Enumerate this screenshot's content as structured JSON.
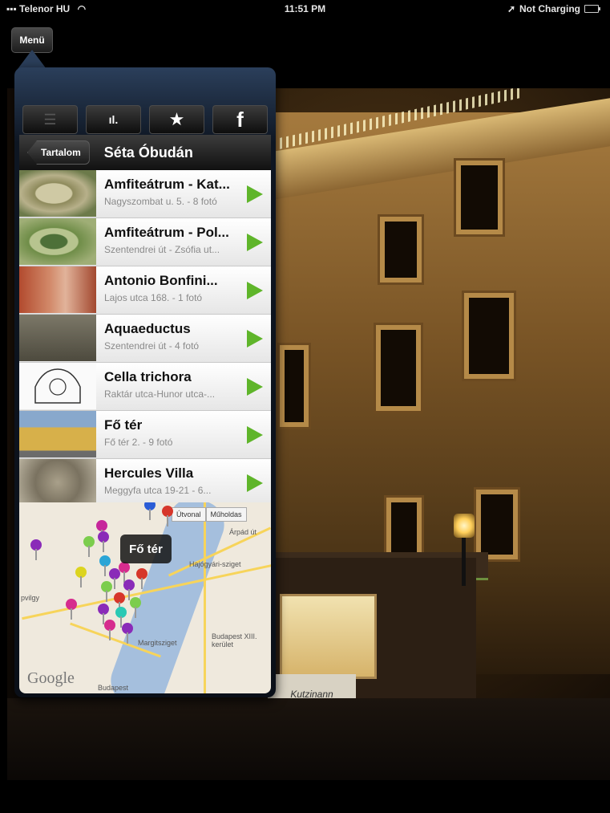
{
  "status_bar": {
    "carrier": "Telenor HU",
    "time": "11:51 PM",
    "battery_text": "Not Charging"
  },
  "menu_button": {
    "label": "Menü"
  },
  "kiosk_sign": "Kutzinann",
  "popover": {
    "toolbar": [
      {
        "name": "list-icon",
        "glyph": "☰"
      },
      {
        "name": "bar-chart-icon",
        "glyph": "ıl."
      },
      {
        "name": "star-icon",
        "glyph": "★"
      },
      {
        "name": "facebook-icon",
        "glyph": "f"
      }
    ],
    "nav": {
      "back_label": "Tartalom",
      "title": "Séta Óbudán"
    },
    "items": [
      {
        "title": "Amfiteátrum - Kat...",
        "subtitle": "Nagyszombat u. 5. - 8 fotó"
      },
      {
        "title": "Amfiteátrum - Pol...",
        "subtitle": "Szentendrei út - Zsófia ut..."
      },
      {
        "title": "Antonio Bonfini...",
        "subtitle": "Lajos utca 168. - 1 fotó"
      },
      {
        "title": "Aquaeductus",
        "subtitle": "Szentendrei út - 4 fotó"
      },
      {
        "title": "Cella trichora",
        "subtitle": "Raktár utca-Hunor utca-..."
      },
      {
        "title": "Fő tér",
        "subtitle": "Fő tér 2. - 9 fotó"
      },
      {
        "title": "Hercules Villa",
        "subtitle": "Meggyfa utca 19-21 - 6..."
      }
    ],
    "map": {
      "callout": "Fő tér",
      "segment_left": "Útvonal",
      "segment_right": "Műholdas",
      "labels": [
        "Árpád út",
        "Hajógyári-sziget",
        "Budapest XIII. kerület",
        "Margitsziget",
        "Budapest",
        "pvilgy"
      ],
      "brand": "Google"
    }
  }
}
